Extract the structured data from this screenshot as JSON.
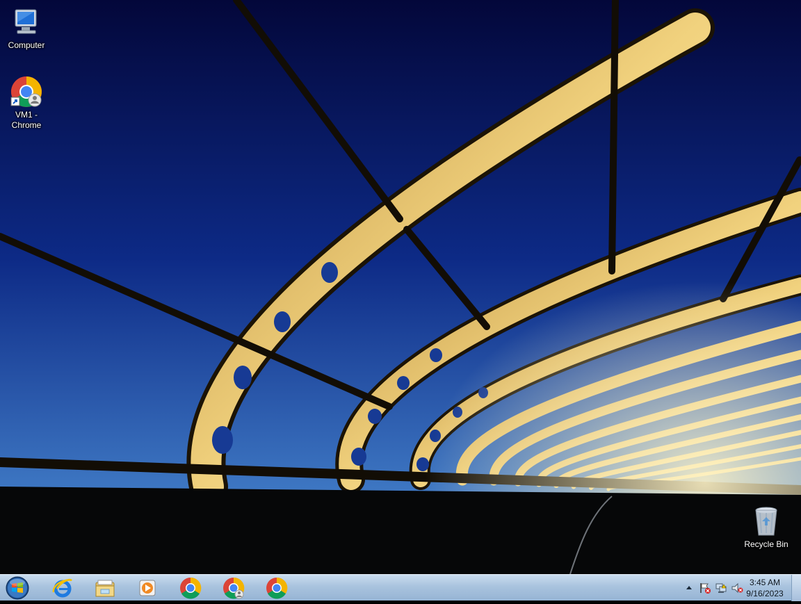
{
  "desktop": {
    "icons": [
      {
        "label": "Computer",
        "icon": "computer-icon"
      },
      {
        "label": "VM1 - Chrome",
        "icon": "chrome-profile-shortcut-icon"
      },
      {
        "label": "Recycle Bin",
        "icon": "recycle-bin-icon"
      }
    ]
  },
  "taskbar": {
    "start": "start-orb-icon",
    "pinned": [
      "internet-explorer-icon",
      "file-explorer-icon",
      "media-player-icon",
      "chrome-icon",
      "chrome-profile-icon",
      "chrome-icon"
    ],
    "tray": {
      "icons": [
        "show-hidden-icons-arrow",
        "action-center-flag-icon",
        "network-icon",
        "volume-muted-icon"
      ],
      "time": "3:45 AM",
      "date": "9/16/2023"
    }
  },
  "colors": {
    "sky_top": "#050a45",
    "sky_bottom": "#2f64b0",
    "bridge_gold": "#d9b25a",
    "taskbar": "#a9c3de"
  }
}
